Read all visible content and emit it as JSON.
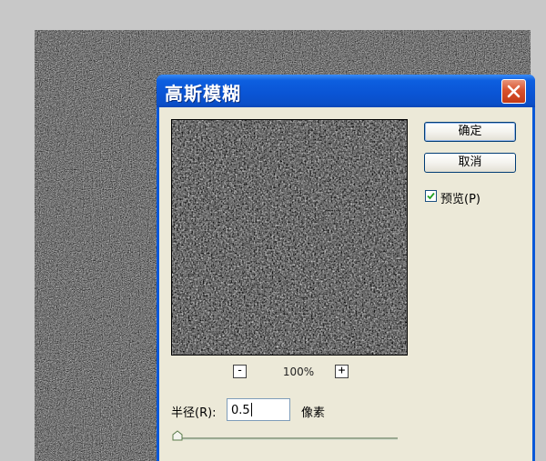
{
  "dialog": {
    "title": "高斯模糊",
    "close_icon": "close-icon",
    "ok_label": "确定",
    "cancel_label": "取消",
    "preview_checkbox": {
      "label": "预览(P)",
      "checked": true
    },
    "zoom": {
      "out_label": "-",
      "level": "100%",
      "in_label": "+"
    },
    "radius": {
      "label": "半径(R):",
      "value": "0.5",
      "unit": "像素"
    },
    "slider": {
      "value_fraction": 0.01
    }
  },
  "colors": {
    "titlebar": "#0a54d4",
    "client_bg": "#ece9d8",
    "close_button": "#d9522d"
  }
}
